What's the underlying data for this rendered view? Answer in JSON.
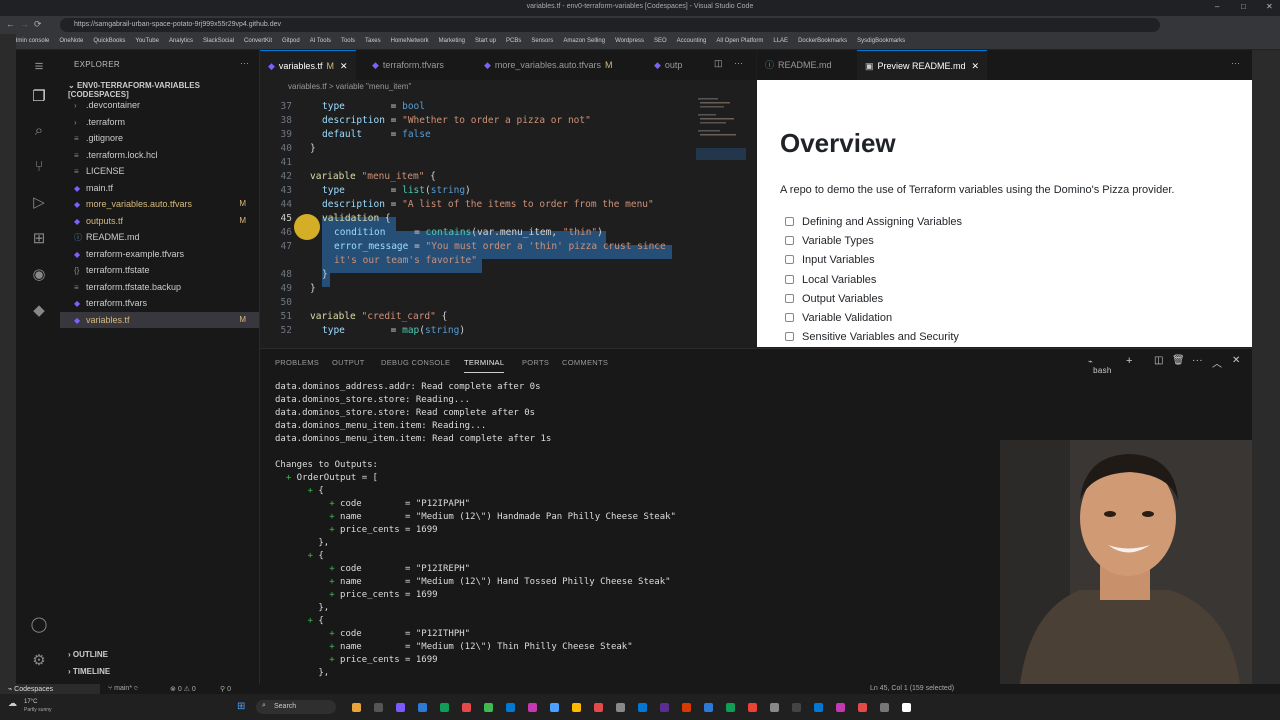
{
  "browser": {
    "title": "variables.tf - env0-terraform-variables [Codespaces] - Visual Studio Code",
    "url": "https://samgabrail-urban-space-potato-9rj999x55r29vp4.github.dev",
    "bookmarks": [
      "Admin console",
      "OneNote",
      "QuickBooks",
      "YouTube",
      "Analytics",
      "SlackSocial",
      "ConvertKit",
      "Gitpod",
      "AI Tools",
      "Tools",
      "Taxes",
      "HomeNetwork",
      "Marketing",
      "Start up",
      "PCBs",
      "Sensors",
      "Amazon Selling",
      "Wordpress",
      "SEO",
      "Accounting",
      "All Open Platform",
      "LLAE",
      "DockerBookmarks",
      "SysdigBookmarks"
    ]
  },
  "explorer": {
    "header": "EXPLORER",
    "project": "ENV0-TERRAFORM-VARIABLES [CODESPACES]",
    "files": [
      {
        "name": ".devcontainer",
        "type": "folder",
        "mod": ""
      },
      {
        "name": ".terraform",
        "type": "folder",
        "mod": ""
      },
      {
        "name": ".gitignore",
        "type": "file",
        "mod": ""
      },
      {
        "name": ".terraform.lock.hcl",
        "type": "file",
        "mod": ""
      },
      {
        "name": "LICENSE",
        "type": "file",
        "mod": ""
      },
      {
        "name": "main.tf",
        "type": "tf",
        "mod": ""
      },
      {
        "name": "more_variables.auto.tfvars",
        "type": "tf",
        "mod": "M"
      },
      {
        "name": "outputs.tf",
        "type": "tf",
        "mod": "M"
      },
      {
        "name": "README.md",
        "type": "md",
        "mod": ""
      },
      {
        "name": "terraform-example.tfvars",
        "type": "tf",
        "mod": ""
      },
      {
        "name": "terraform.tfstate",
        "type": "json",
        "mod": ""
      },
      {
        "name": "terraform.tfstate.backup",
        "type": "file",
        "mod": ""
      },
      {
        "name": "terraform.tfvars",
        "type": "tf",
        "mod": ""
      },
      {
        "name": "variables.tf",
        "type": "tf",
        "mod": "M"
      }
    ],
    "outline": "OUTLINE",
    "timeline": "TIMELINE"
  },
  "tabs": [
    {
      "label": "variables.tf",
      "mod": "M"
    },
    {
      "label": "terraform.tfvars",
      "mod": ""
    },
    {
      "label": "more_variables.auto.tfvars",
      "mod": "M"
    },
    {
      "label": "outp",
      "mod": ""
    }
  ],
  "breadcrumb": "variables.tf  >  variable \"menu_item\"",
  "preview_tabs": [
    "README.md",
    "Preview README.md"
  ],
  "preview": {
    "heading": "Overview",
    "desc": "A repo to demo the use of Terraform variables using the Domino's Pizza provider.",
    "checklist": [
      "Defining and Assigning Variables",
      "Variable Types",
      "Input Variables",
      "Local Variables",
      "Output Variables",
      "Variable Validation",
      "Sensitive Variables and Security"
    ]
  },
  "panel_tabs": [
    "PROBLEMS",
    "OUTPUT",
    "DEBUG CONSOLE",
    "TERMINAL",
    "PORTS",
    "COMMENTS"
  ],
  "shell": "bash",
  "terminal": [
    "data.dominos_address.addr: Read complete after 0s",
    "data.dominos_store.store: Reading...",
    "data.dominos_store.store: Read complete after 0s",
    "data.dominos_menu_item.item: Reading...",
    "data.dominos_menu_item.item: Read complete after 1s",
    "",
    "Changes to Outputs:",
    "  + OrderOutput = [",
    "      + {",
    "          + code        = \"P12IPAPH\"",
    "          + name        = \"Medium (12\\\") Handmade Pan Philly Cheese Steak\"",
    "          + price_cents = 1699",
    "        },",
    "      + {",
    "          + code        = \"P12IREPH\"",
    "          + name        = \"Medium (12\\\") Hand Tossed Philly Cheese Steak\"",
    "          + price_cents = 1699",
    "        },",
    "      + {",
    "          + code        = \"P12ITHPH\"",
    "          + name        = \"Medium (12\\\") Thin Philly Cheese Steak\"",
    "          + price_cents = 1699",
    "        },"
  ],
  "status": {
    "remote": "Codespaces",
    "branch": "main*",
    "errors": "0",
    "warnings": "0",
    "ports": "0",
    "cursor": "Ln 45, Col 1 (159 selected)"
  },
  "taskbar": {
    "search": "Search",
    "weather_temp": "17°C",
    "weather": "Partly sunny"
  }
}
